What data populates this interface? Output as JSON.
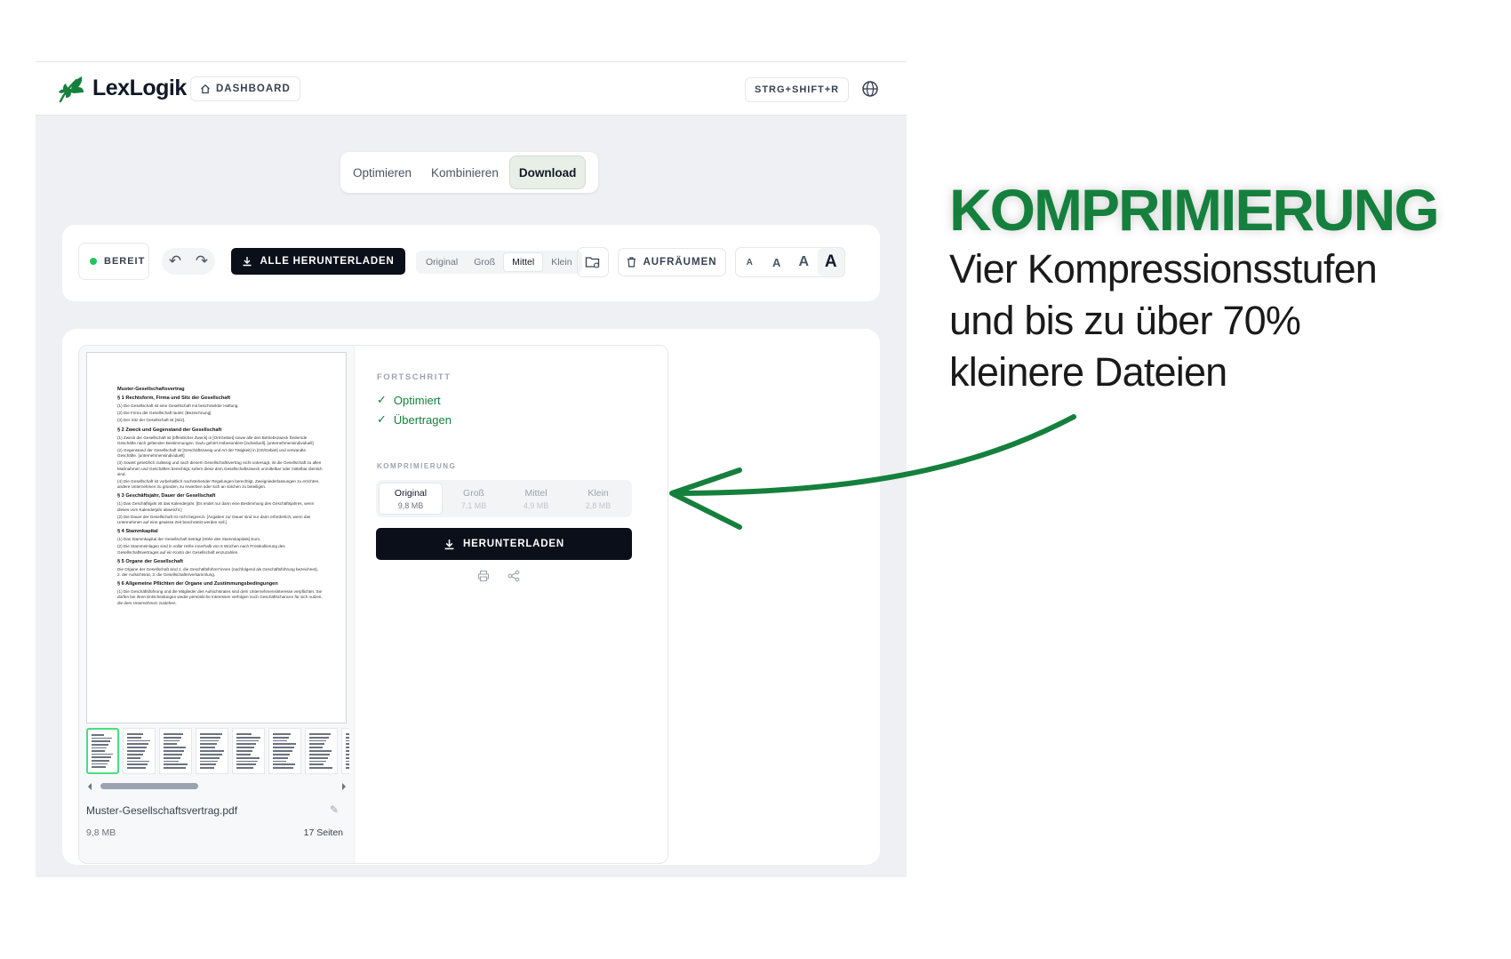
{
  "app": {
    "brand": "LexLogik",
    "dashboard_label": "DASHBOARD",
    "shortcut_label": "STRG+SHIFT+R"
  },
  "modes": {
    "tabs": [
      {
        "label": "Optimieren",
        "active": false
      },
      {
        "label": "Kombinieren",
        "active": false
      },
      {
        "label": "Download",
        "active": true
      }
    ]
  },
  "toolbar": {
    "status": "BEREIT",
    "download_all": "ALLE HERUNTERLADEN",
    "sizes": [
      "Original",
      "Groß",
      "Mittel",
      "Klein"
    ],
    "selected_size": "Mittel",
    "cleanup": "AUFRÄUMEN",
    "font_sizes": [
      "A",
      "A",
      "A",
      "A"
    ]
  },
  "document": {
    "filename": "Muster-Gesellschaftsvertrag.pdf",
    "size": "9,8 MB",
    "pages": "17 Seiten",
    "preview": {
      "title": "Muster-Gesellschaftsvertrag",
      "lines": [
        {
          "t": "h",
          "text": "§ 1 Rechtsform, Firma und Sitz der Gesellschaft"
        },
        {
          "t": "l",
          "text": "(1)   Die Gesellschaft ist eine Gesellschaft mit beschränkter Haftung."
        },
        {
          "t": "l",
          "text": "(2)   Die Firma der Gesellschaft lautet: [Bezeichnung]"
        },
        {
          "t": "l",
          "text": "(3)   Der Sitz der Gesellschaft ist [Sitz]."
        },
        {
          "t": "h",
          "text": "§ 2 Zweck und Gegenstand der Gesellschaft"
        },
        {
          "t": "l",
          "text": "(1)   Zweck der Gesellschaft ist [öffentlicher Zweck] in [Ort/Gebiet] sowie alle den Betriebszweck fördernde Geschäfte nach geltenden Bestimmungen. Dazu gehört insbesondere [individuell]. [unternehmensindividuell]"
        },
        {
          "t": "l",
          "text": "(2)   Gegenstand der Gesellschaft ist [Geschäftszweig und Art der Tätigkeit] in [Ort/Gebiet] und verwandte Geschäfte. [unternehmensindividuell]"
        },
        {
          "t": "l",
          "text": "(3)   Soweit gesetzlich zulässig und nach diesem Gesellschaftsvertrag nicht untersagt, ist die Gesellschaft zu allen Maßnahmen und Geschäften berechtigt, sofern diese dem Gesellschaftszweck unmittelbar oder mittelbar dienlich sind."
        },
        {
          "t": "l",
          "text": "(4)   Die Gesellschaft ist vorbehaltlich nachstehender Regelungen berechtigt, Zweigniederlassungen zu errichten, andere Unternehmen zu gründen, zu erwerben oder sich an solchen zu beteiligen."
        },
        {
          "t": "h",
          "text": "§ 3 Geschäftsjahr, Dauer der Gesellschaft"
        },
        {
          "t": "l",
          "text": "(1)   Das Geschäftsjahr ist das Kalenderjahr. [Es endet nur dann eine Bestimmung des Geschäftsjahres, wenn dieses vom Kalenderjahr abweicht.]"
        },
        {
          "t": "l",
          "text": "(2)   Die Dauer der Gesellschaft ist nicht begrenzt. [Angaben zur Dauer sind nur dann erforderlich, wenn das Unternehmen auf eine gewisse Zeit beschränkt werden soll.]"
        },
        {
          "t": "h",
          "text": "§ 4 Stammkapital"
        },
        {
          "t": "l",
          "text": "(1)   Das Stammkapital der Gesellschaft beträgt [Höhe des Stammkapitals] Euro."
        },
        {
          "t": "l",
          "text": "(2)   Die Stammeinlagen sind in voller Höhe innerhalb von 6 Wochen nach Protokollierung des Gesellschaftsvertrages auf ein Konto der Gesellschaft einzuzahlen."
        },
        {
          "t": "h",
          "text": "§ 5 Organe der Gesellschaft"
        },
        {
          "t": "l",
          "text": "Die Organe der Gesellschaft sind 1. die Geschäftsführer*innen (nachfolgend als Geschäftsführung bezeichnet), 2. der Aufsichtsrat, 3. die Gesellschafterversammlung."
        },
        {
          "t": "h",
          "text": "§ 6 Allgemeine Pflichten der Organe und Zustimmungsbedingungen"
        },
        {
          "t": "l",
          "text": "(1)   Die Geschäftsführung und die Mitglieder des Aufsichtsrates sind dem Unternehmensinteresse verpflichtet. Sie dürfen bei ihren Entscheidungen weder persönliche Interessen verfolgen noch Geschäftschancen für sich nutzen, die dem Unternehmen zustehen."
        }
      ]
    }
  },
  "progress": {
    "label": "FORTSCHRITT",
    "steps": [
      "Optimiert",
      "Übertragen"
    ]
  },
  "compression": {
    "label": "KOMPRIMIERUNG",
    "options": [
      {
        "name": "Original",
        "size": "9,8 MB",
        "active": true
      },
      {
        "name": "Groß",
        "size": "7,1 MB",
        "active": false
      },
      {
        "name": "Mittel",
        "size": "4,9 MB",
        "active": false
      },
      {
        "name": "Klein",
        "size": "2,8 MB",
        "active": false
      }
    ],
    "download": "HERUNTERLADEN"
  },
  "promo": {
    "headline": "KOMPRIMIERUNG",
    "line1": "Vier Kompressionsstufen",
    "line2": "und bis zu über 70%",
    "line3": "kleinere Dateien"
  },
  "colors": {
    "accent_green": "#15803d",
    "status_dot": "#22c55e",
    "primary_button": "#0b0f1a"
  }
}
